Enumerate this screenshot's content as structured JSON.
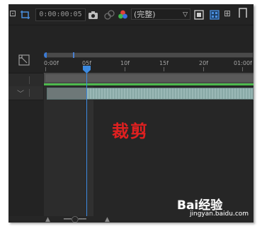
{
  "toolbar": {
    "timecode": "0:00:00:05",
    "quality": "(完整)",
    "left_glyph": "⊡",
    "region_glyph": "⊞"
  },
  "ruler": {
    "labels": [
      "0:00f",
      "05f",
      "10f",
      "15f",
      "20f",
      "01:00f"
    ]
  },
  "layer": {
    "note": "裁剪"
  },
  "watermark": {
    "logo": "Bai经验",
    "url": "jingyan.baidu.com"
  },
  "colors": {
    "playhead": "#3c8ae0",
    "work_area_green": "#4db84d",
    "layer_bar": "#8fb0ad",
    "note_red": "#e02020"
  }
}
